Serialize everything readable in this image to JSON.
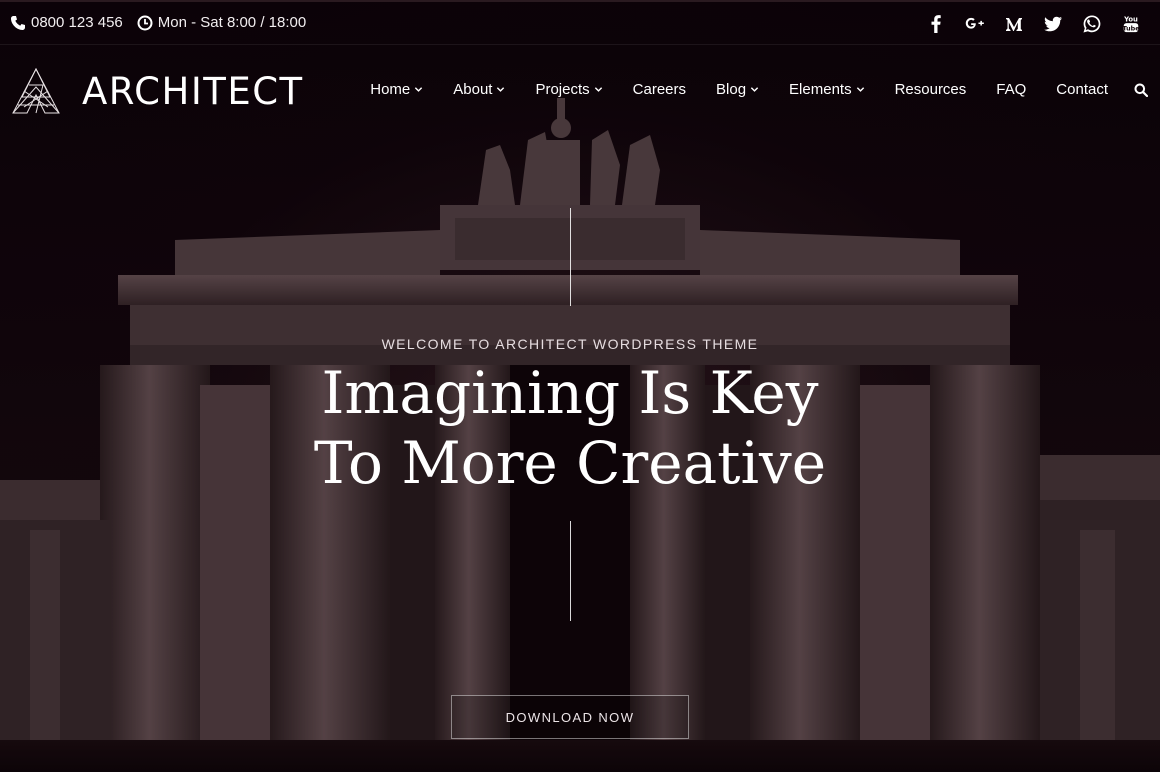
{
  "topbar": {
    "phone": "0800 123 456",
    "hours": "Mon - Sat 8:00 / 18:00",
    "phone_icon": "phone-icon",
    "clock_icon": "clock-icon",
    "social": [
      {
        "name": "facebook-icon"
      },
      {
        "name": "google-plus-icon"
      },
      {
        "name": "medium-icon"
      },
      {
        "name": "twitter-icon"
      },
      {
        "name": "whatsapp-icon"
      },
      {
        "name": "youtube-icon",
        "label": "You Tube"
      }
    ]
  },
  "header": {
    "logo_text": "ARCHITECT",
    "nav": [
      {
        "label": "Home",
        "dropdown": true
      },
      {
        "label": "About",
        "dropdown": true
      },
      {
        "label": "Projects",
        "dropdown": true
      },
      {
        "label": "Careers",
        "dropdown": false
      },
      {
        "label": "Blog",
        "dropdown": true
      },
      {
        "label": "Elements",
        "dropdown": true
      },
      {
        "label": "Resources",
        "dropdown": false
      },
      {
        "label": "FAQ",
        "dropdown": false
      },
      {
        "label": "Contact",
        "dropdown": false
      }
    ],
    "search_icon": "search-icon"
  },
  "hero": {
    "eyebrow": "WELCOME TO ARCHITECT WORDPRESS THEME",
    "headline_line1": "Imagining Is Key",
    "headline_line2": "To More Creative",
    "cta_label": "DOWNLOAD NOW"
  },
  "colors": {
    "background": "#0a0306",
    "text": "#ffffff",
    "stone": "#6b5558"
  }
}
